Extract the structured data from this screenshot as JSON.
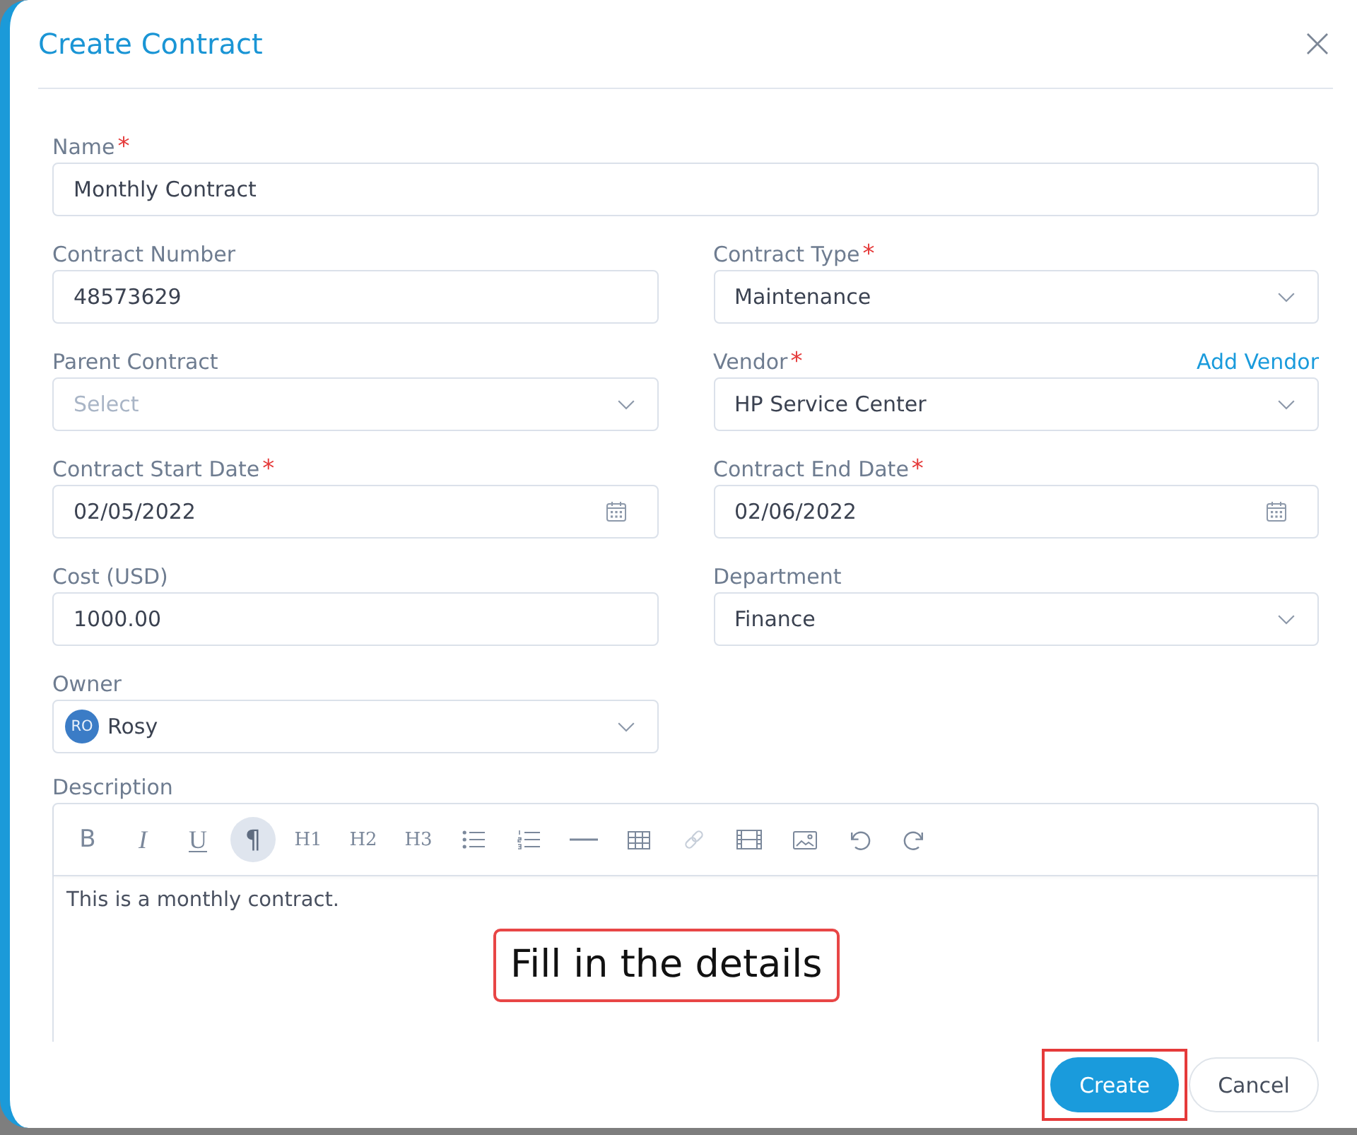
{
  "dialog": {
    "title": "Create Contract"
  },
  "form": {
    "name_field": {
      "label": "Name",
      "required_mark": "*",
      "kind": "text",
      "value": "Monthly Contract"
    },
    "fields": [
      {
        "label": "Contract Number",
        "kind": "text",
        "value": "48573629"
      },
      {
        "label": "Contract Type",
        "required_mark": "*",
        "kind": "select",
        "value": "Maintenance"
      },
      {
        "label": "Parent Contract",
        "kind": "select",
        "placeholder": "Select"
      },
      {
        "label": "Vendor",
        "required_mark": "*",
        "kind": "select",
        "value": "HP Service Center",
        "action": "Add Vendor"
      },
      {
        "label": "Contract Start Date",
        "required_mark": "*",
        "kind": "date",
        "value": "02/05/2022"
      },
      {
        "label": "Contract End Date",
        "required_mark": "*",
        "kind": "date",
        "value": "02/06/2022"
      },
      {
        "label": "Cost (USD)",
        "kind": "text",
        "value": "1000.00"
      },
      {
        "label": "Department",
        "kind": "select",
        "value": "Finance"
      },
      {
        "label": "Owner",
        "kind": "person",
        "value": "Rosy",
        "initials": "RO"
      }
    ],
    "description": {
      "label": "Description",
      "toolbar": [
        {
          "kind": "bold",
          "label": "B",
          "selected": false,
          "disabled": false
        },
        {
          "kind": "italic",
          "label": "I",
          "selected": false,
          "disabled": false
        },
        {
          "kind": "underline",
          "label": "U",
          "selected": false,
          "disabled": false
        },
        {
          "kind": "paragraph",
          "label": "¶",
          "selected": true,
          "disabled": false
        },
        {
          "kind": "heading",
          "label": "H1",
          "selected": false,
          "disabled": false
        },
        {
          "kind": "heading",
          "label": "H2",
          "selected": false,
          "disabled": false
        },
        {
          "kind": "heading",
          "label": "H3",
          "selected": false,
          "disabled": false
        },
        {
          "kind": "bullets",
          "selected": false,
          "disabled": false
        },
        {
          "kind": "numbers",
          "selected": false,
          "disabled": false
        },
        {
          "kind": "rule",
          "selected": false,
          "disabled": false
        },
        {
          "kind": "table",
          "selected": false,
          "disabled": false
        },
        {
          "kind": "link",
          "selected": false,
          "disabled": true
        },
        {
          "kind": "film",
          "selected": false,
          "disabled": false
        },
        {
          "kind": "image",
          "selected": false,
          "disabled": false
        },
        {
          "kind": "undo",
          "selected": false,
          "disabled": false
        },
        {
          "kind": "redo",
          "selected": false,
          "disabled": false
        }
      ],
      "value": "This is a monthly contract."
    }
  },
  "callout": {
    "text": "Fill in the details"
  },
  "buttons": [
    {
      "label": "Create",
      "kind": "primary",
      "highlighted": true
    },
    {
      "label": "Cancel",
      "kind": "secondary",
      "highlighted": false
    }
  ]
}
